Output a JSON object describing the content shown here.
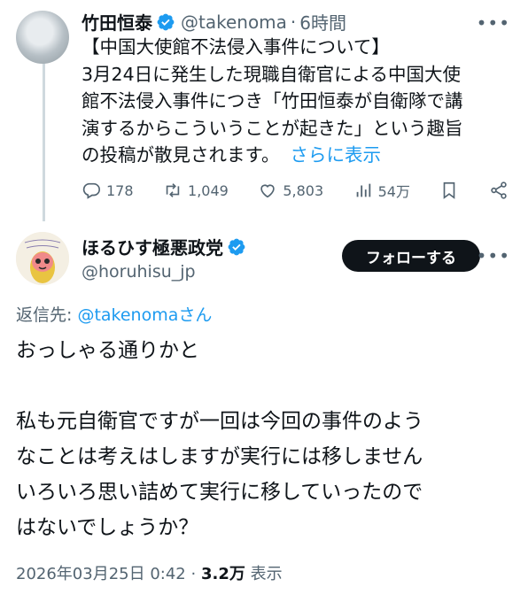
{
  "parent_tweet": {
    "name": "竹田恒泰",
    "handle": "@takenoma",
    "separator": "·",
    "time": "6時間",
    "lines": [
      "【中国大使館不法侵入事件について】",
      "3月24日に発生した現職自衛官による中国大使",
      "館不法侵入事件につき「竹田恒泰が自衛隊で講",
      "演するからこういうことが起きた」という趣旨",
      "の投稿が散見されます。"
    ],
    "show_more": "さらに表示",
    "actions": {
      "replies": "178",
      "retweets": "1,049",
      "likes": "5,803",
      "views": "54万"
    }
  },
  "reply_tweet": {
    "name": "ほるひす極悪政党",
    "handle": "@horuhisu_jp",
    "follow_label": "フォローする",
    "reply_to_prefix": "返信先: ",
    "reply_to_mention": "@takenomaさん",
    "lines": [
      "おっしゃる通りかと",
      "",
      "私も元自衛官ですが一回は今回の事件のよう",
      "なことは考えはしますが実行には移しません",
      "いろいろ思い詰めて実行に移していったので",
      "はないでしょうか？"
    ],
    "timestamp": "2026年03月25日 0:42",
    "meta_separator": "·",
    "views_count": "3.2万",
    "views_label": "表示"
  },
  "colors": {
    "accent": "#1d9bf0",
    "text": "#0f1419",
    "secondary": "#536471",
    "verified": "#1d9bf0"
  },
  "icons": [
    "reply-icon",
    "retweet-icon",
    "like-icon",
    "views-icon",
    "bookmark-icon",
    "share-icon",
    "verified-badge-icon",
    "more-icon"
  ]
}
